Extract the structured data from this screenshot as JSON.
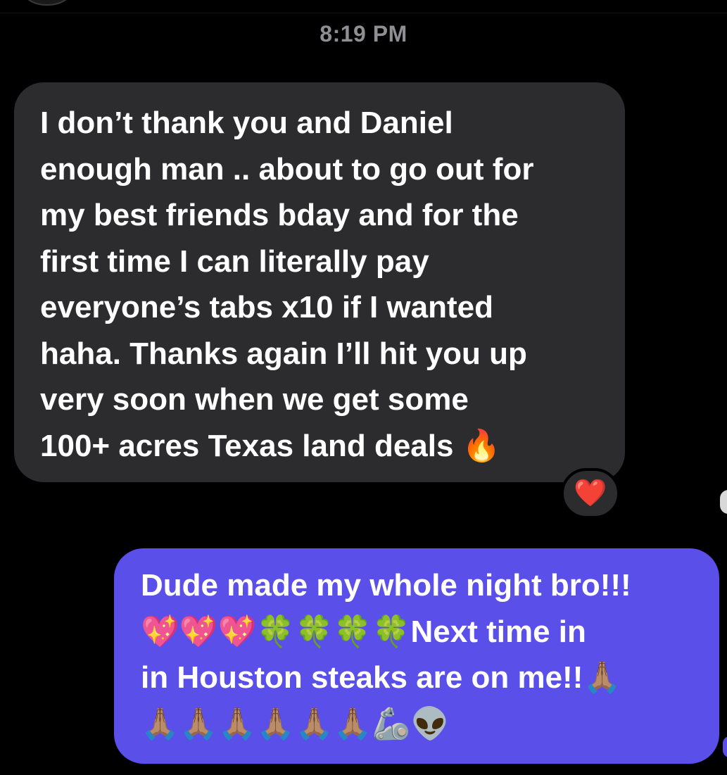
{
  "timestamp": "8:19 PM",
  "incoming_message": {
    "lines": [
      "I don’t thank you and Daniel",
      "enough man .. about to go out for",
      "my best friends bday and for the",
      "first time I can literally pay",
      "everyone’s tabs x10 if I wanted",
      "haha. Thanks again I’ll hit you up",
      "very soon when we get some",
      "100+ acres Texas land deals 🔥"
    ],
    "reaction": "❤️"
  },
  "outgoing_message": {
    "lines": [
      "Dude made my whole night bro!!!",
      "💖💖💖🍀🍀🍀🍀Next time in",
      "in Houston steaks are on me!!🙏🏽",
      "🙏🏽🙏🏽🙏🏽🙏🏽🙏🏽🙏🏽🦾👽"
    ]
  },
  "colors": {
    "background": "#000000",
    "incoming_bubble": "#2c2c2e",
    "outgoing_bubble": "#5b4fe9",
    "timestamp_text": "#8e8e93"
  }
}
